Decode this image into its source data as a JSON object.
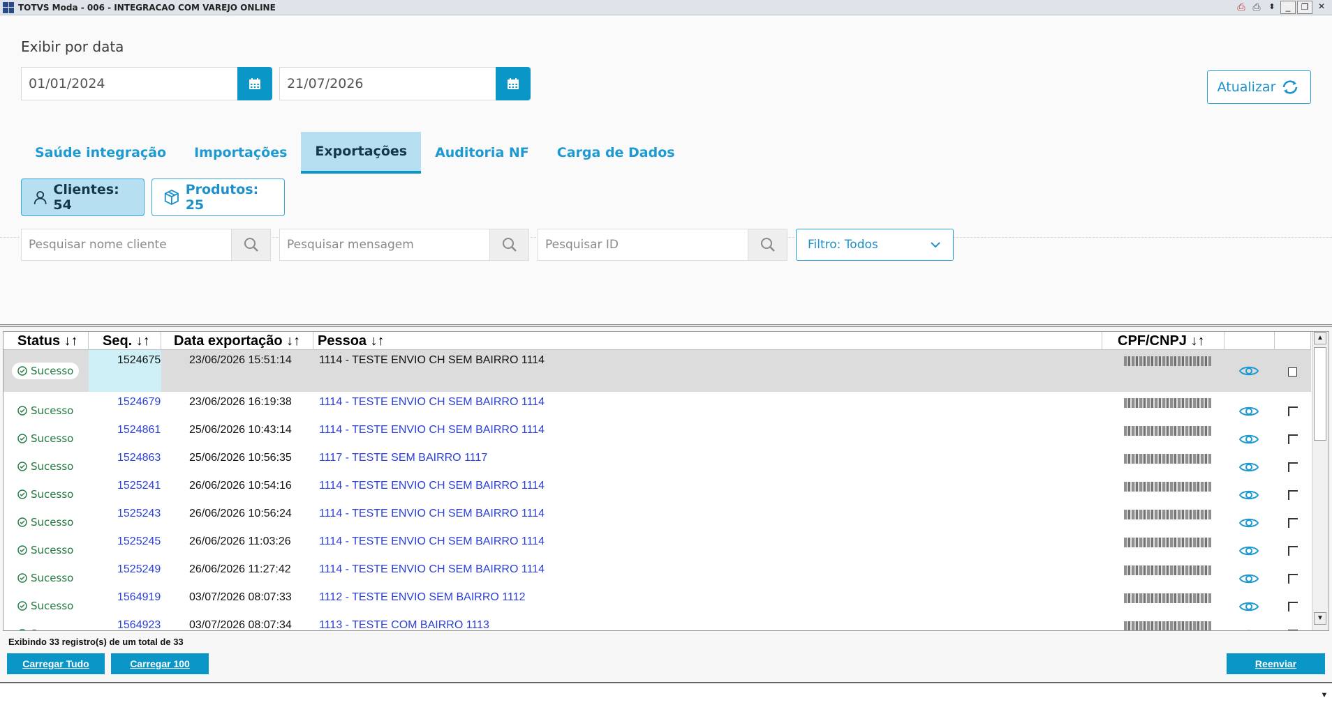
{
  "window": {
    "title": "TOTVS Moda - 006 - INTEGRACAO COM VAREJO ONLINE"
  },
  "filters": {
    "label": "Exibir por data",
    "date_from": "01/01/2024",
    "date_to": "21/07/2026",
    "refresh_label": "Atualizar"
  },
  "tabs": [
    {
      "label": "Saúde integração",
      "active": false
    },
    {
      "label": "Importações",
      "active": false
    },
    {
      "label": "Exportações",
      "active": true
    },
    {
      "label": "Auditoria NF",
      "active": false
    },
    {
      "label": "Carga de Dados",
      "active": false
    }
  ],
  "subtabs": {
    "clientes": "Clientes: 54",
    "produtos": "Produtos: 25"
  },
  "search": {
    "nome_placeholder": "Pesquisar nome cliente",
    "mensagem_placeholder": "Pesquisar mensagem",
    "id_placeholder": "Pesquisar ID",
    "filtro_label": "Filtro: Todos"
  },
  "table": {
    "columns": [
      "Status ↓↑",
      "Seq. ↓↑",
      "Data exportação ↓↑",
      "Pessoa ↓↑",
      "CPF/CNPJ ↓↑"
    ],
    "rows": [
      {
        "status": "Sucesso",
        "seq": "1524675",
        "data": "23/06/2026 15:51:14",
        "pessoa": "1114 - TESTE ENVIO CH SEM BAIRRO 1114"
      },
      {
        "status": "Sucesso",
        "seq": "1524679",
        "data": "23/06/2026 16:19:38",
        "pessoa": "1114 - TESTE ENVIO CH SEM BAIRRO 1114"
      },
      {
        "status": "Sucesso",
        "seq": "1524861",
        "data": "25/06/2026 10:43:14",
        "pessoa": "1114 - TESTE ENVIO CH SEM BAIRRO 1114"
      },
      {
        "status": "Sucesso",
        "seq": "1524863",
        "data": "25/06/2026 10:56:35",
        "pessoa": "1117 - TESTE SEM BAIRRO 1117"
      },
      {
        "status": "Sucesso",
        "seq": "1525241",
        "data": "26/06/2026 10:54:16",
        "pessoa": "1114 - TESTE ENVIO CH SEM BAIRRO 1114"
      },
      {
        "status": "Sucesso",
        "seq": "1525243",
        "data": "26/06/2026 10:56:24",
        "pessoa": "1114 - TESTE ENVIO CH SEM BAIRRO 1114"
      },
      {
        "status": "Sucesso",
        "seq": "1525245",
        "data": "26/06/2026 11:03:26",
        "pessoa": "1114 - TESTE ENVIO CH SEM BAIRRO 1114"
      },
      {
        "status": "Sucesso",
        "seq": "1525249",
        "data": "26/06/2026 11:27:42",
        "pessoa": "1114 - TESTE ENVIO CH SEM BAIRRO 1114"
      },
      {
        "status": "Sucesso",
        "seq": "1564919",
        "data": "03/07/2026 08:07:33",
        "pessoa": "1112 - TESTE ENVIO SEM BAIRRO 1112"
      },
      {
        "status": "Sucesso",
        "seq": "1564923",
        "data": "03/07/2026 08:07:34",
        "pessoa": "1113 - TESTE COM BAIRRO 1113"
      }
    ]
  },
  "footer": {
    "info": "Exibindo 33 registro(s) de um total de 33",
    "carregar_tudo": "Carregar Tudo",
    "carregar_100": "Carregar 100",
    "reenviar": "Reenviar"
  },
  "colors": {
    "accent": "#0b96c8",
    "link": "#2b3fd6",
    "success": "#207a3d",
    "active_tab_bg": "#b7dff2"
  }
}
